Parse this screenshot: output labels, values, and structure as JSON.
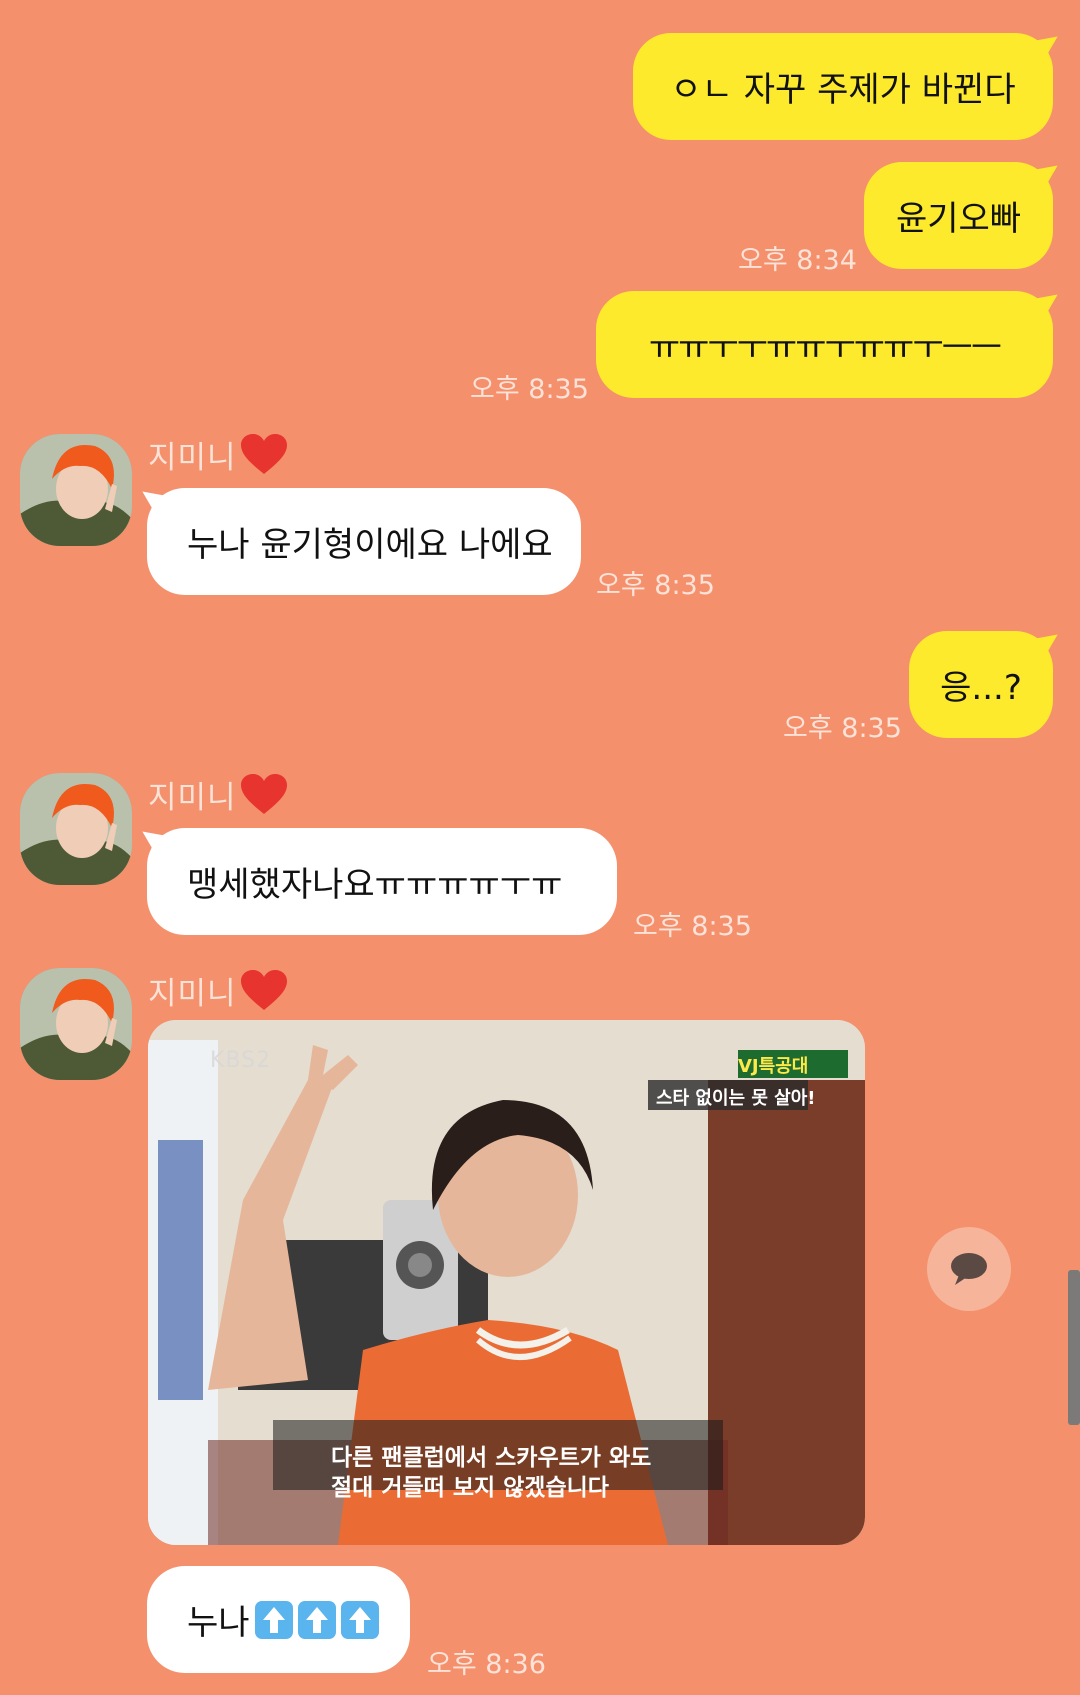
{
  "messages": [
    {
      "side": "me",
      "text": "ㅇㄴ 자꾸 주제가 바뀐다",
      "time": ""
    },
    {
      "side": "me",
      "text": "윤기오빠",
      "time": "오후 8:34"
    },
    {
      "side": "me",
      "text": "ㅠㅠㅜㅜㅠㅠㅜㅠㅠㅜㅡㅡ",
      "time": "오후 8:35"
    },
    {
      "side": "them",
      "sender": "지미니",
      "text": "누나 윤기형이에요 나에요",
      "time": "오후 8:35"
    },
    {
      "side": "me",
      "text": "응...?",
      "time": "오후 8:35"
    },
    {
      "side": "them",
      "sender": "지미니",
      "text": "맹세했자나요ㅠㅠㅠㅠㅜㅠ",
      "time": "오후 8:35"
    },
    {
      "side": "them",
      "sender": "지미니",
      "image": {
        "channel": "KBS2",
        "program_badge": "VJ특공대",
        "caption_top": "스타 없이는 못 살아!",
        "subtitle_line1": "다른 팬클럽에서 스카우트가 와도",
        "subtitle_line2": "절대 거들떠 보지 않겠습니다"
      }
    },
    {
      "side": "them",
      "text": "누나",
      "emoji": [
        "up-arrow",
        "up-arrow",
        "up-arrow"
      ],
      "time": "오후 8:36"
    }
  ],
  "colors": {
    "background": "#f4906c",
    "my_bubble": "#fdea2c",
    "their_bubble": "#ffffff",
    "timestamp": "#fde2d8"
  },
  "icons": {
    "reply": "speech-bubble-icon",
    "heart": "heart-icon"
  }
}
